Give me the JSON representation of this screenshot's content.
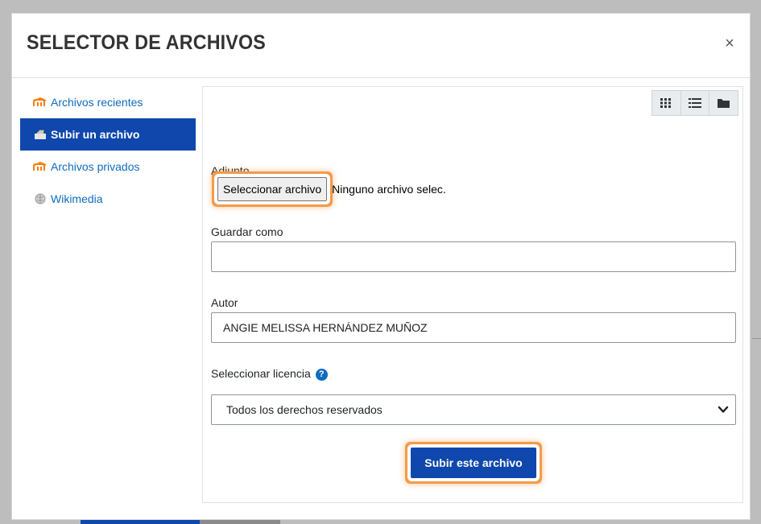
{
  "dialog": {
    "title": "SELECTOR DE ARCHIVOS",
    "close_label": "×"
  },
  "sidebar": {
    "items": [
      {
        "label": "Archivos recientes",
        "icon": "moodle-icon",
        "active": false
      },
      {
        "label": "Subir un archivo",
        "icon": "upload-icon",
        "active": true
      },
      {
        "label": "Archivos privados",
        "icon": "moodle-icon",
        "active": false
      },
      {
        "label": "Wikimedia",
        "icon": "wikimedia-icon",
        "active": false
      }
    ]
  },
  "toolbar": {
    "views": [
      "grid-view-icon",
      "list-view-icon",
      "folder-view-icon"
    ]
  },
  "form": {
    "attachment_label": "Adjunto",
    "choose_button": "Seleccionar archivo",
    "no_file_text": "Ninguno archivo selec.",
    "save_as_label": "Guardar como",
    "save_as_value": "",
    "author_label": "Autor",
    "author_value": "ANGIE MELISSA HERNÁNDEZ MUÑOZ",
    "license_label": "Seleccionar licencia",
    "license_value": "Todos los derechos reservados",
    "submit_button": "Subir este archivo"
  },
  "colors": {
    "accent": "#0f47ad",
    "link": "#0f6cbf",
    "highlight": "#f39b4a",
    "moodle_orange": "#f98012"
  }
}
